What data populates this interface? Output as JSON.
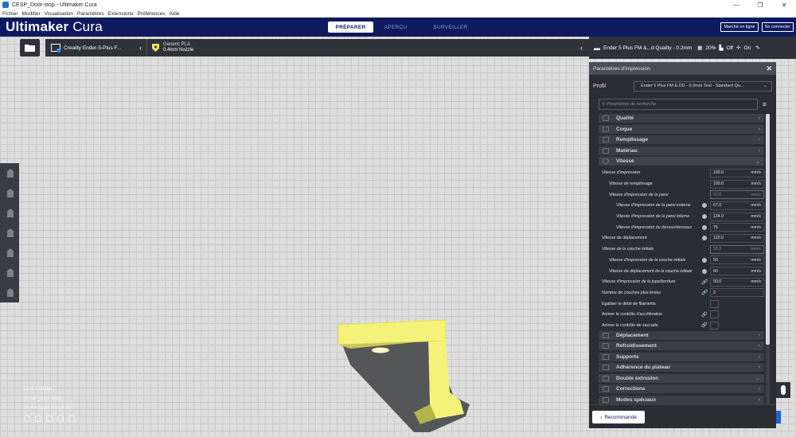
{
  "window": {
    "title": "CESP_Door-stop - Ultimaker Cura",
    "controls": [
      "—",
      "❐",
      "✕"
    ]
  },
  "menu": [
    "Fichier",
    "Modifier",
    "Visualisation",
    "Paramètres",
    "Extensions",
    "Préférences",
    "Aide"
  ],
  "header": {
    "logo_bold": "Ultimaker",
    "logo_light": " Cura",
    "tabs": [
      "PRÉPARER",
      "APERÇU",
      "SURVEILLER"
    ],
    "marketplace": "Marché en ligne",
    "signin": "Se connecter"
  },
  "toolbar": {
    "printer": "Creality Ender-5-Plus F...",
    "material_name": "Generic PLA",
    "nozzle": "0.4mm Nozzle"
  },
  "summary": {
    "profile": "Ender 5 Plus FM &...d Quality - 0.2mm",
    "infill": "20%",
    "support": "Off",
    "adhesion": "On"
  },
  "panel": {
    "title": "Paramètres d'impression",
    "profile_label": "Profil",
    "profile_value": "Ender 5 Plus FM & DD - 0.2mm Test - Standard Qu...",
    "search_placeholder": "Paramètres de recherche",
    "categories_top": [
      "Qualité",
      "Coque",
      "Remplissage",
      "Matériau"
    ],
    "open_category": "Vitesse",
    "settings": [
      {
        "name": "Vitesse d'impression",
        "value": "100.0",
        "unit": "mm/s",
        "indent": 0,
        "dim": false,
        "badge": false
      },
      {
        "name": "Vitesse de remplissage",
        "value": "100.0",
        "unit": "mm/s",
        "indent": 1,
        "dim": false,
        "badge": false
      },
      {
        "name": "Vitesse d'impression de la paroi",
        "value": "50.0",
        "unit": "mm/s",
        "indent": 1,
        "dim": true,
        "badge": false
      },
      {
        "name": "Vitesse d'impression de la paroi externe",
        "value": "67.0",
        "unit": "mm/s",
        "indent": 2,
        "dim": false,
        "badge": true
      },
      {
        "name": "Vitesse d'impression de la paroi interne",
        "value": "134.0",
        "unit": "mm/s",
        "indent": 2,
        "dim": false,
        "badge": true
      },
      {
        "name": "Vitesse d'impression du dessus/dessous",
        "value": "75",
        "unit": "mm/s",
        "indent": 2,
        "dim": false,
        "badge": true
      },
      {
        "name": "Vitesse de déplacement",
        "value": "120.0",
        "unit": "mm/s",
        "indent": 0,
        "dim": false,
        "badge": true
      },
      {
        "name": "Vitesse de la couche initiale",
        "value": "50.0",
        "unit": "mm/s",
        "indent": 0,
        "dim": true,
        "badge": false
      },
      {
        "name": "Vitesse d'impression de la couche initiale",
        "value": "50",
        "unit": "mm/s",
        "indent": 1,
        "dim": false,
        "badge": true
      },
      {
        "name": "Vitesse de déplacement de la couche initiale",
        "value": "60",
        "unit": "mm/s",
        "indent": 1,
        "dim": false,
        "badge": true
      },
      {
        "name": "Vitesse d'impression de la jupe/bordure",
        "value": "50.0",
        "unit": "mm/s",
        "indent": 0,
        "dim": false,
        "link": true
      },
      {
        "name": "Nombre de couches plus lentes",
        "value": "2",
        "unit": "",
        "indent": 0,
        "dim": false,
        "link": true
      }
    ],
    "checkbox_settings": [
      {
        "name": "Égaliser le débit de filaments",
        "link": false
      },
      {
        "name": "Activer le contrôle d'accélération",
        "link": true
      },
      {
        "name": "Activer le contrôle de saccade",
        "link": true
      }
    ],
    "categories_bottom": [
      "Déplacement",
      "Refroidissement",
      "Supports",
      "Adhérence du plateau"
    ],
    "open_category_2": "Double extrusion",
    "categories_end": [
      "Corrections",
      "Modes spéciaux"
    ],
    "recommended": "Recommandé"
  },
  "objects": {
    "list_label": "Liste d'objets",
    "file_name": "CESP_Door-stop",
    "dimensions": "25.4 x 110.0 x 25.0 mm"
  },
  "colors": {
    "header": "#0f1a5e",
    "accent": "#1766d6",
    "model": "#f5f27a"
  }
}
